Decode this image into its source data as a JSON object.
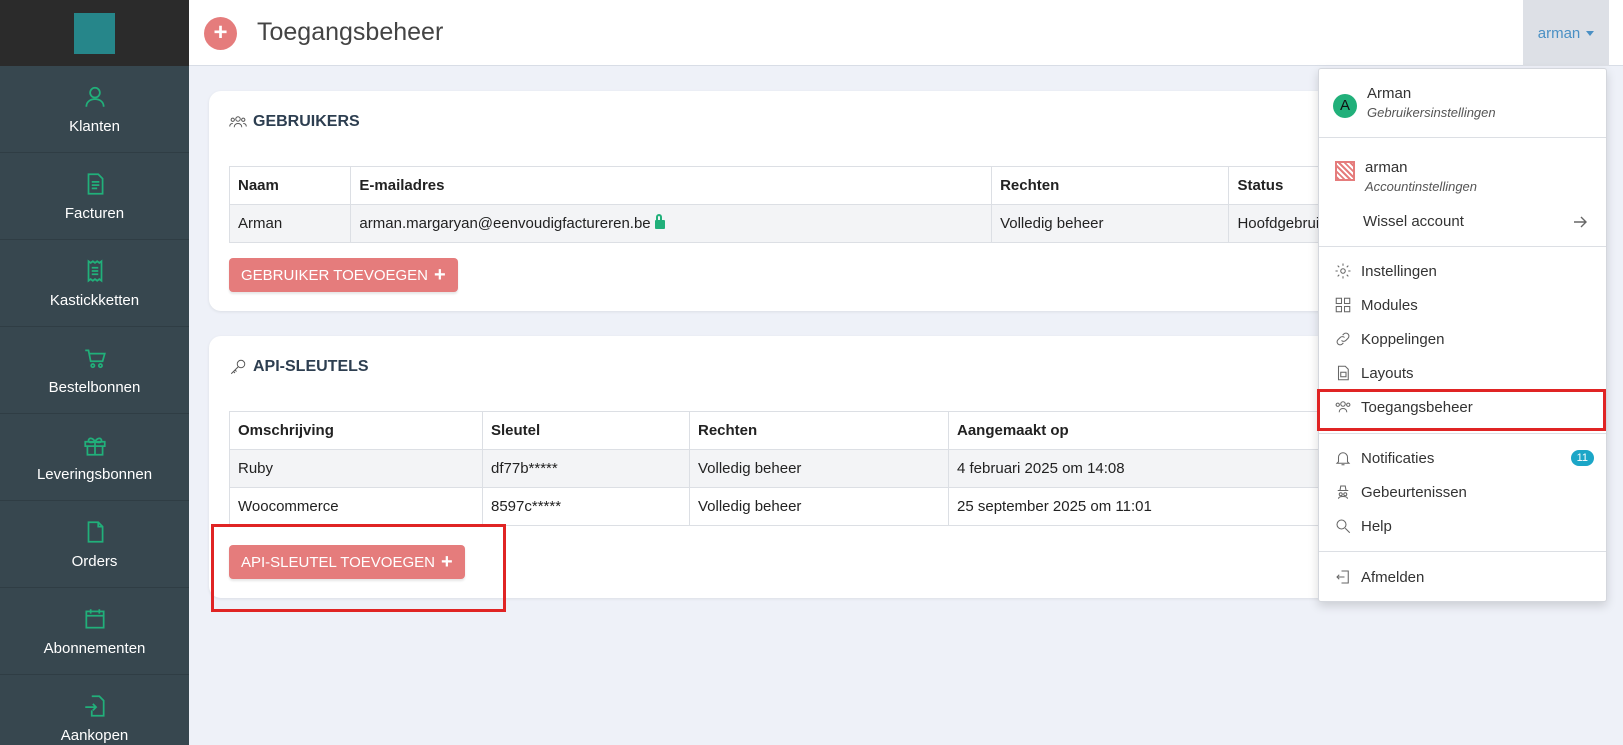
{
  "sidebar": {
    "items": [
      {
        "label": "Klanten",
        "icon": "user-icon"
      },
      {
        "label": "Facturen",
        "icon": "invoice-icon"
      },
      {
        "label": "Kastickketten",
        "icon": "receipt-icon"
      },
      {
        "label": "Bestelbonnen",
        "icon": "cart-icon"
      },
      {
        "label": "Leveringsbonnen",
        "icon": "box-icon"
      },
      {
        "label": "Orders",
        "icon": "document-icon"
      },
      {
        "label": "Abonnementen",
        "icon": "calendar-icon"
      },
      {
        "label": "Aankopen",
        "icon": "import-icon"
      }
    ]
  },
  "header": {
    "title": "Toegangsbeheer",
    "add_symbol": "+",
    "user_label": "arman"
  },
  "users_card": {
    "title": "GEBRUIKERS",
    "columns": [
      "Naam",
      "E-mailadres",
      "Rechten",
      "Status"
    ],
    "rows": [
      {
        "naam": "Arman",
        "email": "arman.margaryan@eenvoudigfactureren.be",
        "rechten": "Volledig beheer",
        "status": "Hoofdgebruiker"
      }
    ],
    "add_button": "GEBRUIKER TOEVOEGEN"
  },
  "api_card": {
    "title": "API-SLEUTELS",
    "columns": [
      "Omschrijving",
      "Sleutel",
      "Rechten",
      "Aangemaakt op"
    ],
    "rows": [
      {
        "omschrijving": "Ruby",
        "sleutel": "df77b*****",
        "rechten": "Volledig beheer",
        "aangemaakt": "4 februari 2025 om 14:08"
      },
      {
        "omschrijving": "Woocommerce",
        "sleutel": "8597c*****",
        "rechten": "Volledig beheer",
        "aangemaakt": "25 september 2025 om 11:01"
      }
    ],
    "add_button": "API-SLEUTEL TOEVOEGEN"
  },
  "dropdown": {
    "user_name": "Arman",
    "user_initial": "A",
    "user_sub": "Gebruikersinstellingen",
    "account_name": "arman",
    "account_sub": "Accountinstellingen",
    "switch_account": "Wissel account",
    "items": [
      "Instellingen",
      "Modules",
      "Koppelingen",
      "Layouts",
      "Toegangsbeheer"
    ],
    "items2": [
      "Notificaties",
      "Gebeurtenissen",
      "Help"
    ],
    "notifications_count": "11",
    "logout": "Afmelden"
  },
  "colors": {
    "sidebar": "#37474f",
    "accent": "#21b07a",
    "button": "#e57c7c",
    "highlight": "#e02424",
    "badge": "#1ba6c7"
  }
}
